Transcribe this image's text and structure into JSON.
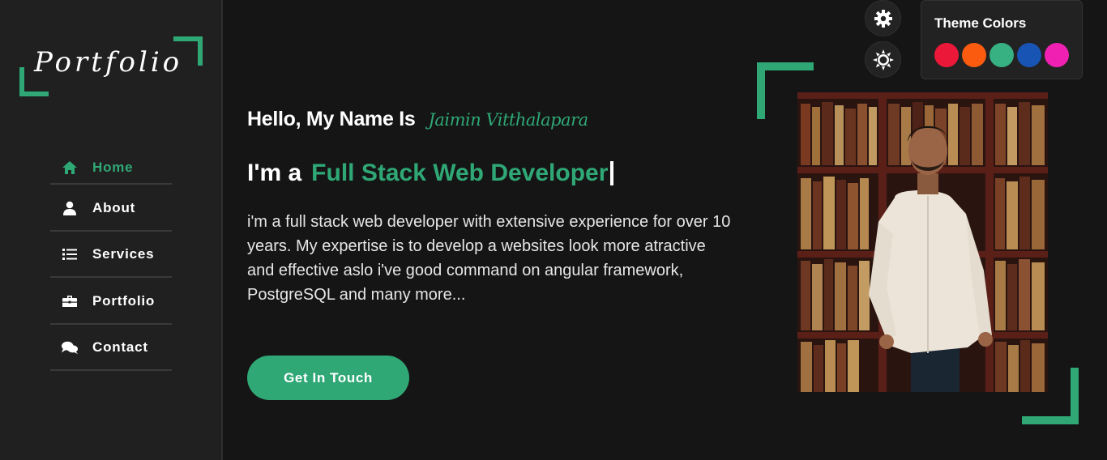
{
  "logo": {
    "text": "Portfolio"
  },
  "nav": {
    "items": [
      {
        "label": "Home",
        "icon": "home-icon",
        "active": true
      },
      {
        "label": "About",
        "icon": "user-icon",
        "active": false
      },
      {
        "label": "Services",
        "icon": "list-icon",
        "active": false
      },
      {
        "label": "Portfolio",
        "icon": "briefcase-icon",
        "active": false
      },
      {
        "label": "Contact",
        "icon": "comments-icon",
        "active": false
      }
    ]
  },
  "hero": {
    "greeting": "Hello, My Name Is",
    "name": "Jaimin Vitthalapara",
    "role_prefix": "I'm a",
    "role": "Full Stack Web Developer",
    "description": "i'm a full stack web developer with extensive experience for over 10 years. My expertise is to develop a websites look more atractive and effective aslo i've good command on angular framework, PostgreSQL and many more...",
    "cta_label": "Get In Touch"
  },
  "theme": {
    "title": "Theme Colors",
    "colors": [
      "#ec1839",
      "#fa5b0f",
      "#37b182",
      "#1854b4",
      "#f021b2"
    ],
    "accent": "#2fa876"
  }
}
